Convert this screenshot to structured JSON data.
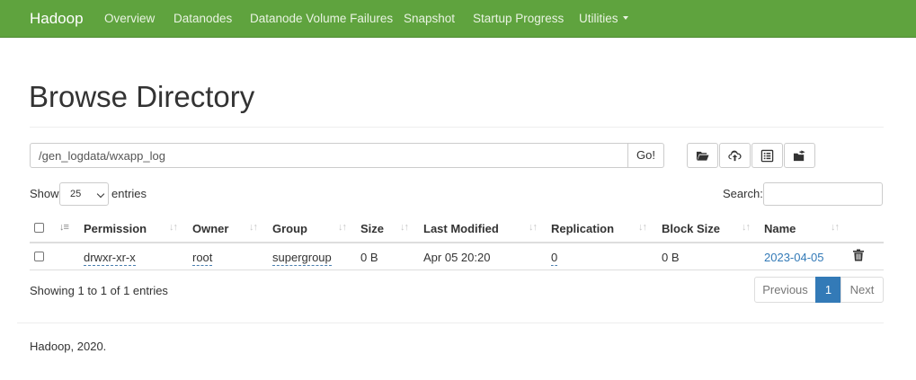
{
  "navbar": {
    "brand": "Hadoop",
    "items": [
      "Overview",
      "Datanodes",
      "Datanode Volume Failures",
      "Snapshot",
      "Startup Progress",
      "Utilities"
    ],
    "bg_color": "#5fa33e"
  },
  "page": {
    "title": "Browse Directory"
  },
  "path_bar": {
    "value": "/gen_logdata/wxapp_log",
    "go_label": "Go!",
    "tools": [
      "folder-open-icon",
      "cloud-upload-icon",
      "list-alt-icon",
      "folder-move-icon"
    ]
  },
  "table_controls": {
    "show_label": "Show",
    "page_length": "25",
    "entries_label": "entries",
    "search_label": "Search:"
  },
  "table": {
    "columns": [
      "Permission",
      "Owner",
      "Group",
      "Size",
      "Last Modified",
      "Replication",
      "Block Size",
      "Name"
    ],
    "rows": [
      {
        "permission": "drwxr-xr-x",
        "owner": "root",
        "group": "supergroup",
        "size": "0 B",
        "last_modified": "Apr 05 20:20",
        "replication": "0",
        "block_size": "0 B",
        "name": "2023-04-05"
      }
    ]
  },
  "pagination": {
    "info": "Showing 1 to 1 of 1 entries",
    "previous": "Previous",
    "current": "1",
    "next": "Next",
    "accent": "#337ab7"
  },
  "footer": {
    "text": "Hadoop, 2020."
  }
}
